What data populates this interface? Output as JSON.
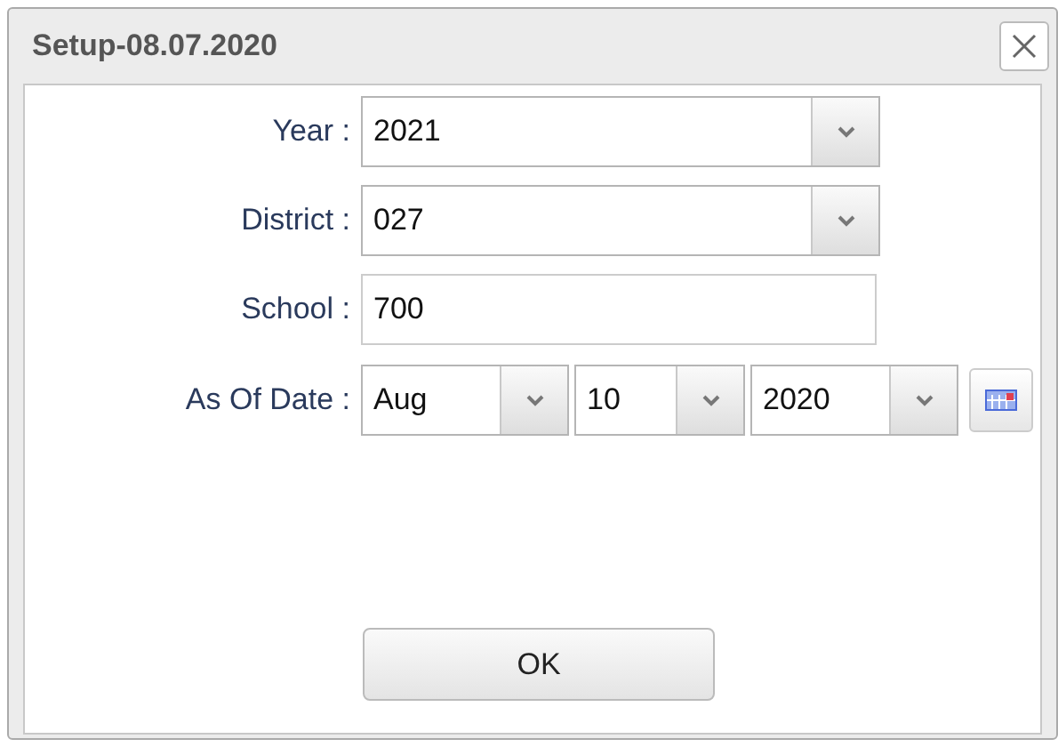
{
  "window": {
    "title": "Setup-08.07.2020"
  },
  "fields": [
    {
      "kind": "select",
      "label": "Year :",
      "value": "2021"
    },
    {
      "kind": "select",
      "label": "District :",
      "value": "027"
    },
    {
      "kind": "text",
      "label": "School :",
      "value": "700"
    }
  ],
  "as_of_date": {
    "label": "As Of Date :",
    "month": "Aug",
    "day": "10",
    "year": "2020"
  },
  "buttons": [
    "OK"
  ]
}
